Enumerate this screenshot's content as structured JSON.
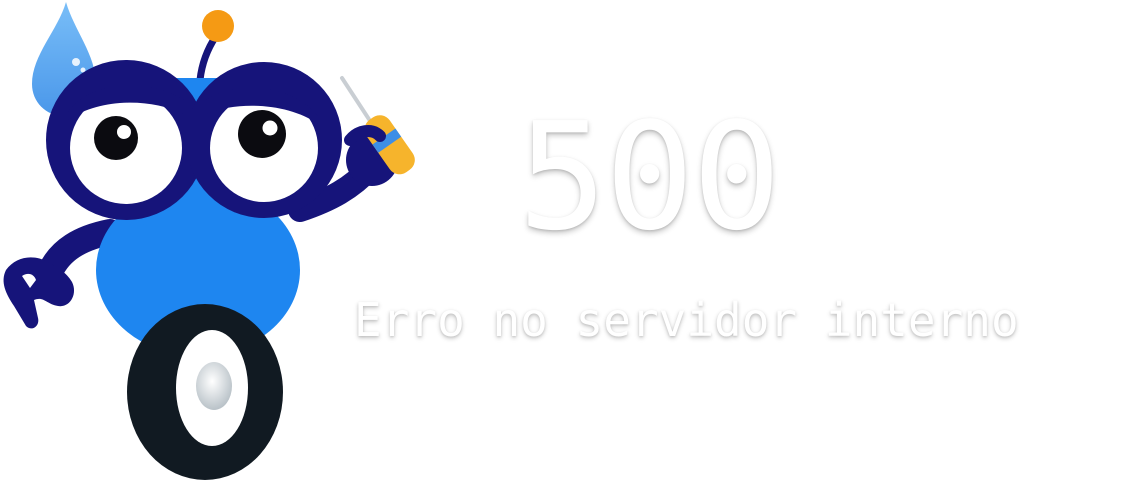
{
  "error": {
    "code": "500",
    "message": "Erro no servidor interno"
  },
  "illustration": {
    "icon": "sad-robot-mechanic-icon",
    "colors": {
      "body_blue": "#1e86f0",
      "dark_navy": "#16147a",
      "antenna_orange": "#f59a14",
      "wheel_dark": "#111a22",
      "droplet_blue": "#4da3f2"
    }
  }
}
